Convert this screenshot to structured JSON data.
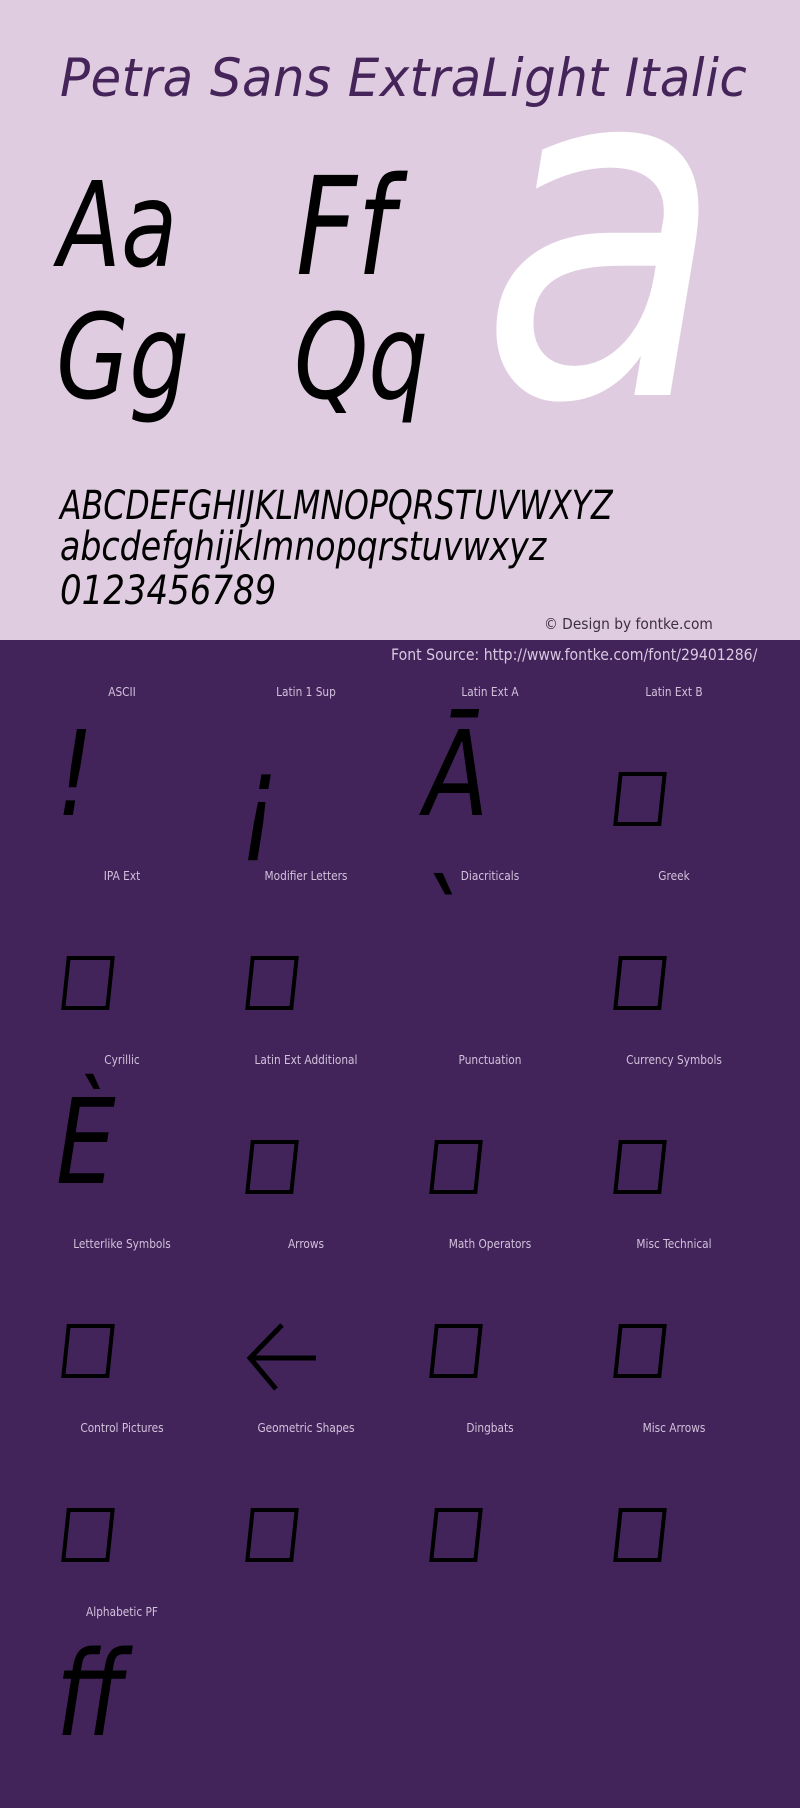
{
  "header": {
    "title": "Petra Sans ExtraLight Italic",
    "samples": {
      "pair1": "Aa",
      "pair2": "Ff",
      "pair3": "Gg",
      "pair4": "Qq",
      "big": "a"
    },
    "alphabet": {
      "upper": "ABCDEFGHIJKLMNOPQRSTUVWXYZ",
      "lower": "abcdefghijklmnopqrstuvwxyz",
      "digits": "0123456789"
    },
    "copyright": "© Design by fontke.com"
  },
  "source": {
    "text": "Font Source: http://www.fontke.com/font/29401286/"
  },
  "colors": {
    "top_background": "#e0cce0",
    "bottom_background": "#42245a",
    "title": "#45245a",
    "big_glyph": "#ffffff",
    "glyph": "#000000",
    "label": "#d2c2dc"
  },
  "blocks": [
    {
      "label": "ASCII",
      "glyph": "!",
      "missing": false
    },
    {
      "label": "Latin 1 Sup",
      "glyph": "¡",
      "missing": false
    },
    {
      "label": "Latin Ext A",
      "glyph": "Ā",
      "missing": false
    },
    {
      "label": "Latin Ext B",
      "glyph": "",
      "missing": true
    },
    {
      "label": "IPA Ext",
      "glyph": "",
      "missing": true
    },
    {
      "label": "Modifier Letters",
      "glyph": "",
      "missing": true
    },
    {
      "label": "Diacriticals",
      "glyph": "̀",
      "missing": false
    },
    {
      "label": "Greek",
      "glyph": "",
      "missing": true
    },
    {
      "label": "Cyrillic",
      "glyph": "È",
      "missing": false
    },
    {
      "label": "Latin Ext Additional",
      "glyph": "",
      "missing": true
    },
    {
      "label": "Punctuation",
      "glyph": "",
      "missing": true
    },
    {
      "label": "Currency Symbols",
      "glyph": "",
      "missing": true
    },
    {
      "label": "Letterlike Symbols",
      "glyph": "",
      "missing": true
    },
    {
      "label": "Arrows",
      "glyph": "←",
      "missing": false
    },
    {
      "label": "Math Operators",
      "glyph": "",
      "missing": true
    },
    {
      "label": "Misc Technical",
      "glyph": "",
      "missing": true
    },
    {
      "label": "Control Pictures",
      "glyph": "",
      "missing": true
    },
    {
      "label": "Geometric Shapes",
      "glyph": "",
      "missing": true
    },
    {
      "label": "Dingbats",
      "glyph": "",
      "missing": true
    },
    {
      "label": "Misc Arrows",
      "glyph": "",
      "missing": true
    },
    {
      "label": "Alphabetic PF",
      "glyph": "ff",
      "missing": false
    }
  ]
}
